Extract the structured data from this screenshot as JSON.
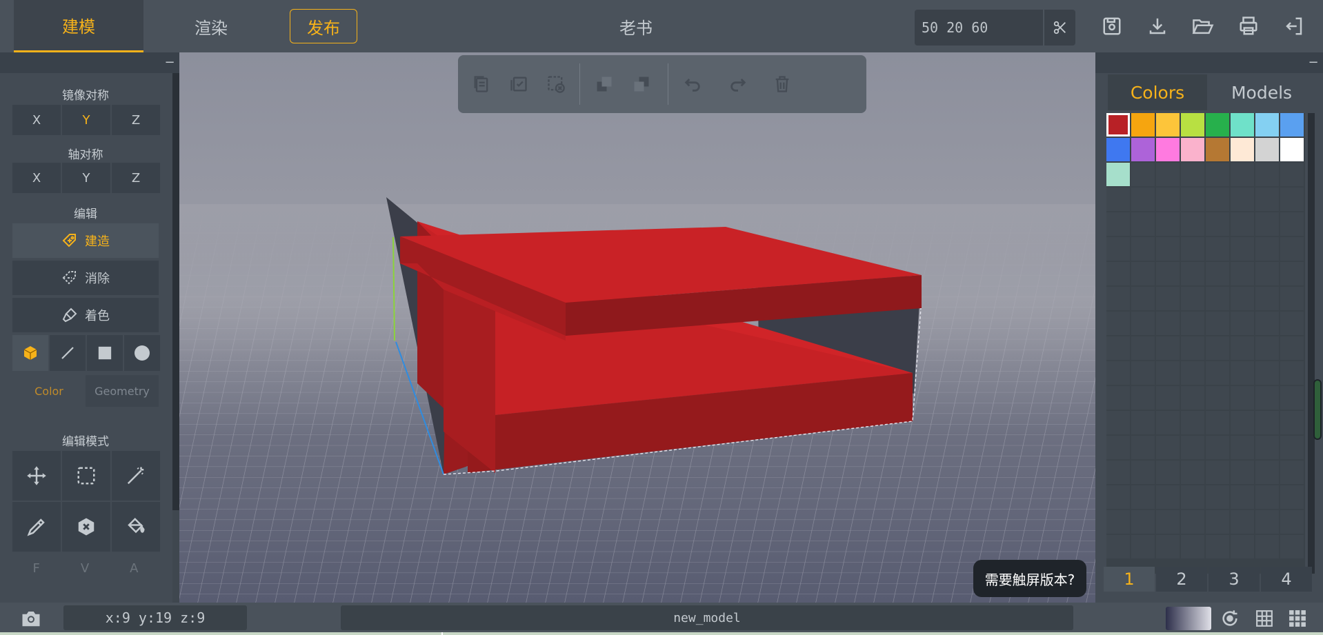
{
  "top": {
    "tabs": {
      "model": "建模",
      "render": "渲染",
      "publish": "发布"
    },
    "title": "老书",
    "size_value": "50 20 60"
  },
  "left": {
    "mirror_title": "镜像对称",
    "mirror_axes": [
      "X",
      "Y",
      "Z"
    ],
    "mirror_active": "Y",
    "axis_title": "轴对称",
    "axis_axes": [
      "X",
      "Y",
      "Z"
    ],
    "edit_title": "编辑",
    "tools": {
      "build": "建造",
      "erase": "消除",
      "paint": "着色"
    },
    "mode_tabs": {
      "color": "Color",
      "geometry": "Geometry"
    },
    "edit_mode_title": "编辑模式",
    "fva": [
      "F",
      "V",
      "A"
    ]
  },
  "right": {
    "tabs": {
      "colors": "Colors",
      "models": "Models"
    },
    "palette": [
      "#b82126",
      "#f6a50f",
      "#fdc53a",
      "#b8e042",
      "#27b04c",
      "#6fe1c9",
      "#84d0f2",
      "#5aa0f0",
      "#3f78f0",
      "#ad63d9",
      "#ff7ae0",
      "#fab2cc",
      "#b57833",
      "#fee9d6",
      "#d3d3d3",
      "#ffffff",
      "#a6dfcb"
    ],
    "pages": [
      "1",
      "2",
      "3",
      "4"
    ]
  },
  "viewport": {
    "touch_prompt": "需要触屏版本?"
  },
  "bottom": {
    "coords": "x:9 y:19 z:9",
    "model_name": "new_model"
  }
}
